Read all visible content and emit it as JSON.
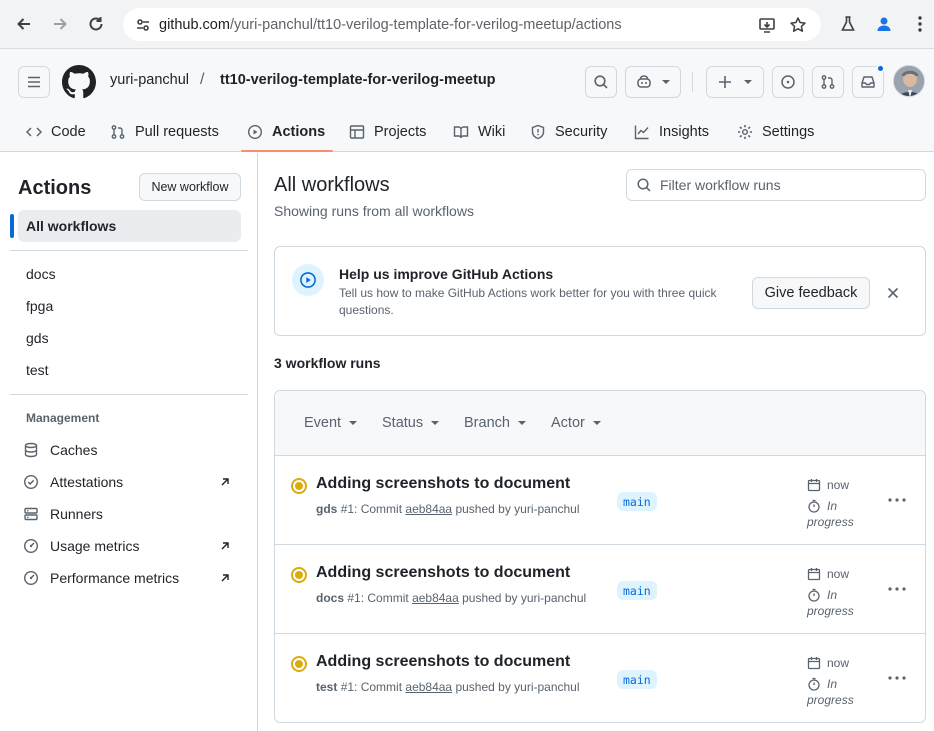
{
  "browser": {
    "url_host": "github.com",
    "url_path": "/yuri-panchul/tt10-verilog-template-for-verilog-meetup/actions"
  },
  "header": {
    "owner": "yuri-panchul",
    "separator": "/",
    "repo": "tt10-verilog-template-for-verilog-meetup"
  },
  "tabs": [
    {
      "label": "Code",
      "icon": "code-icon"
    },
    {
      "label": "Pull requests",
      "icon": "pull-request-icon"
    },
    {
      "label": "Actions",
      "icon": "play-icon",
      "active": true
    },
    {
      "label": "Projects",
      "icon": "table-icon"
    },
    {
      "label": "Wiki",
      "icon": "book-icon"
    },
    {
      "label": "Security",
      "icon": "shield-icon"
    },
    {
      "label": "Insights",
      "icon": "graph-icon"
    },
    {
      "label": "Settings",
      "icon": "gear-icon"
    }
  ],
  "sidebar": {
    "title": "Actions",
    "new_workflow": "New workflow",
    "all_workflows": "All workflows",
    "workflows": [
      "docs",
      "fpga",
      "gds",
      "test"
    ],
    "management_title": "Management",
    "management": [
      {
        "label": "Caches",
        "icon": "database-icon"
      },
      {
        "label": "Attestations",
        "icon": "verified-icon",
        "external": true
      },
      {
        "label": "Runners",
        "icon": "server-icon"
      },
      {
        "label": "Usage metrics",
        "icon": "meter-icon",
        "external": true
      },
      {
        "label": "Performance metrics",
        "icon": "meter-icon",
        "external": true
      }
    ]
  },
  "main": {
    "title": "All workflows",
    "subtitle": "Showing runs from all workflows",
    "filter_placeholder": "Filter workflow runs",
    "banner": {
      "title": "Help us improve GitHub Actions",
      "text": "Tell us how to make GitHub Actions work better for you with three quick questions.",
      "button": "Give feedback"
    },
    "run_count": "3 workflow runs",
    "filters": [
      "Event",
      "Status",
      "Branch",
      "Actor"
    ],
    "runs": [
      {
        "title": "Adding screenshots to document",
        "workflow": "gds",
        "number": "#1",
        "commit_prefix": ": Commit ",
        "sha": "aeb84aa",
        "pushed_by": " pushed by yuri-panchul",
        "branch": "main",
        "time": "now",
        "state": "In progress",
        "state_line2": "progress",
        "state_line1": "In"
      },
      {
        "title": "Adding screenshots to document",
        "workflow": "docs",
        "number": "#1",
        "commit_prefix": ": Commit ",
        "sha": "aeb84aa",
        "pushed_by": " pushed by yuri-panchul",
        "branch": "main",
        "time": "now",
        "state": "In progress",
        "state_line2": "progress",
        "state_line1": "In"
      },
      {
        "title": "Adding screenshots to document",
        "workflow": "test",
        "number": "#1",
        "commit_prefix": ": Commit ",
        "sha": "aeb84aa",
        "pushed_by": " pushed by yuri-panchul",
        "branch": "main",
        "time": "now",
        "state": "In progress",
        "state_line2": "progress",
        "state_line1": "In"
      }
    ]
  },
  "colors": {
    "accent": "#0969da",
    "tab_underline": "#fd8c73",
    "in_progress": "#dbab0a",
    "branch_bg": "#ddf4ff"
  }
}
